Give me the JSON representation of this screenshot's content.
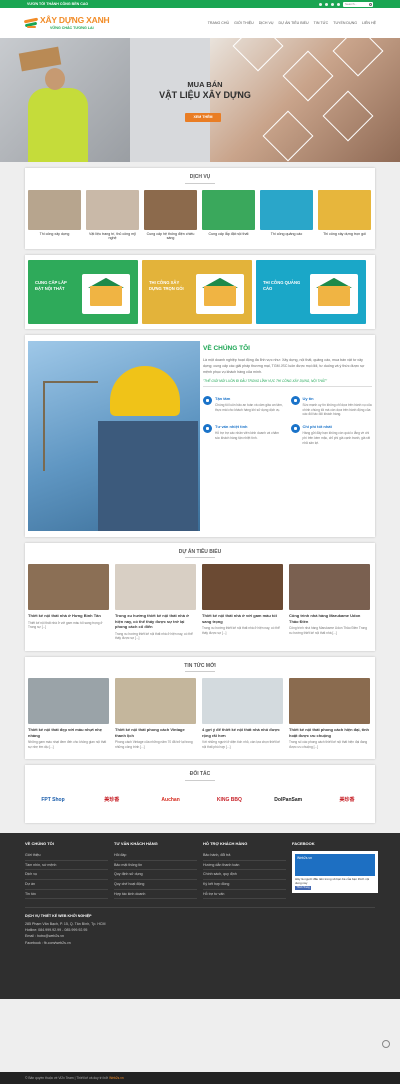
{
  "topbar": {
    "slogan": "VƯƠN TỚI THÀNH CÔNG BỀN CAO",
    "search_placeholder": "Search..."
  },
  "logo": {
    "name": "XÂY DỰNG XANH",
    "tagline": "VỮNG CHẮC TƯƠNG LAI"
  },
  "nav": [
    "TRANG CHỦ",
    "GIỚI THIỆU",
    "DỊCH VỤ",
    "DỰ ÁN TIÊU BIỂU",
    "TIN TỨC",
    "TUYỂN DỤNG",
    "LIÊN HỆ"
  ],
  "hero": {
    "line1": "MUA BÁN",
    "line2": "VẬT LIỆU XÂY DỰNG",
    "button": "XEM THÊM"
  },
  "services": {
    "title": "DỊCH VỤ",
    "items": [
      {
        "label": "Thi công xây dựng",
        "color": "#b7a58e"
      },
      {
        "label": "Vật liệu trang trí, thủ công mỹ nghệ",
        "color": "#c9b9a8"
      },
      {
        "label": "Cung cấp hệ thống điện chiếu sáng",
        "color": "#8c6a4c"
      },
      {
        "label": "Cung cấp lắp đặt nội thất",
        "color": "#3aa85c"
      },
      {
        "label": "Thi công quảng cáo",
        "color": "#2aa6c9"
      },
      {
        "label": "Thi công xây dựng trọn gói",
        "color": "#e7b63c"
      }
    ]
  },
  "banners": [
    {
      "label": "CUNG CẤP LẮP ĐẶT NỘI THẤT",
      "color": "#2eaa5a"
    },
    {
      "label": "THI CÔNG XÂY DỰNG TRỌN GÓI",
      "color": "#e3b33a"
    },
    {
      "label": "THI CÔNG QUẢNG CÁO",
      "color": "#1aa7c8"
    }
  ],
  "about": {
    "title": "VỀ CHÚNG TÔI",
    "text": "Là một doanh nghiệp hoạt động đa lĩnh vực như: Xây dựng, nội thất, quảng cáo, mua bán vật tư xây dựng; cung cấp các giải pháp thương mại, TGM JSC luôn được mọi đối, tư duống và ý thức được sự mệnh phục vụ khách hàng của mình.",
    "quote": "\"THẾ GIỚI MỚI LUÔN ĐI ĐẦU TRONG LĨNH VỰC THI CÔNG XÂY DỰNG, NỘI THẤT\"",
    "features": [
      {
        "title": "Tận tâm",
        "desc": "Chúng tôi luôn bảo an toàn và cảm giác an tâm, thực mái cho khách hàng khi sử dụng dịch vụ."
      },
      {
        "title": "Uy tín",
        "desc": "Sức mạnh uy tín không chỉ dựa trên hành vụ của chính chúng tôi mà còn dựa trên hành động của các đối tác đối khách hàng."
      },
      {
        "title": "Tư vấn nhiệt tình",
        "desc": "Hỗ trợ trợ các nhân viên kinh doanh và chăm sóc khách hàng tận nhiệt tình."
      },
      {
        "title": "Chi phí tốt nhất",
        "desc": "Hàng gửi đây bạn không còn quá lo lắng về chi phí trên kèm mặc, chỉ phí giá cạnh tranh, giá rất nhã sản lợi."
      }
    ]
  },
  "projects": {
    "title": "DỰ ÁN TIÊU BIỂU",
    "items": [
      {
        "title": "Thiết kế nội thất nhà ở Hưng Bình Tân",
        "desc": "Thiết kế nội thất nhà ở với gam màu tối sang trọng ở Trong sự [...]",
        "color": "#8b6f55"
      },
      {
        "title": "Trong xu hướng thiết kế nội thất nhà ở hiện nay, có thể thấy được sự trở lại phong cách cổ điển",
        "desc": "Trong xu hướng thiết kế nội thất nhà ở hiện nay, có thể thấy được sự [...]",
        "color": "#d8cfc4"
      },
      {
        "title": "Thiết kế nội thất nhà ở với gam màu tối sang trọng",
        "desc": "Trong xu hướng thiết kế nội thất nhà ở hiện nay, có thể thấy được sự [...]",
        "color": "#6b4a33"
      },
      {
        "title": "Công trình nhà hàng Marukame Udon Thảo Điền",
        "desc": "Công trình nhà hàng Marukame Udon Thảo Điền Trong xu hướng thiết kế nội thất nhà [...]",
        "color": "#7a6050"
      }
    ]
  },
  "news": {
    "title": "TIN TỨC MỚI",
    "items": [
      {
        "title": "Thiết kế nội thất đẹp với màu nhựt nhẹ nhàng",
        "desc": "Những gam màu nhạt đem đến cho không gian nội thất sự nhẹ êm dịu [...]",
        "color": "#9aa3a8"
      },
      {
        "title": "Thiết kế nội thất phong cách Vintage thanh lịch",
        "desc": "Phong cách Vintage của những năm 70 đã trở lại trong những công trình [...]",
        "color": "#c4b69c"
      },
      {
        "title": "4 gợi ý để thiết kế nội thất nhà nhỏ được rộng rãi hơn",
        "desc": "Với những người ở diện tích nhỏ, cần lựa chọn thiết kế nội thất phù hợp [...]",
        "color": "#d3dade"
      },
      {
        "title": "Thiết kế nội thất phong cách hiện đại, tinh hoặt được ưu chuộng",
        "desc": "Trong số các phong cách thiết kế nội thất hiện đại đang được ưu chuộng [...]",
        "color": "#8a6b4f"
      }
    ]
  },
  "partners": {
    "title": "ĐỐI TÁC",
    "items": [
      {
        "name": "FPT Shop",
        "color": "#1a5dab"
      },
      {
        "name": "美珍香",
        "color": "#c8232a"
      },
      {
        "name": "Auchan",
        "color": "#d52b1e"
      },
      {
        "name": "KING BBQ",
        "color": "#c8232a"
      },
      {
        "name": "DolPanSam",
        "color": "#222222"
      },
      {
        "name": "美珍香",
        "color": "#c8232a"
      }
    ]
  },
  "footer": {
    "cols": [
      {
        "title": "VỀ CHÚNG TÔI",
        "items": [
          "Giới thiệu",
          "Tầm nhìn, sứ mệnh",
          "Dịch vụ",
          "Dự án",
          "Tin tức"
        ]
      },
      {
        "title": "TƯ VẤN KHÁCH HÀNG",
        "items": [
          "Hỏi đáp",
          "Bảo mật thông tin",
          "Quy định sử dụng",
          "Quy chế hoạt động",
          "Hợp tác kinh doanh"
        ]
      },
      {
        "title": "HỖ TRỢ KHÁCH HÀNG",
        "items": [
          "Bảo hành, đổi trả",
          "Hướng dẫn thanh toán",
          "Chính sách, quy định",
          "Ký kết hợp đồng",
          "Hỗ trợ tư vấn"
        ]
      }
    ],
    "facebook": {
      "title": "FACEBOOK",
      "page": "Web2s.vn",
      "text": "Hãy là người đầu tiên trong số bạn bè của bạn thích nội dung này",
      "button": "Thích Trang"
    },
    "company": "DỊCH VỤ THIẾT KẾ WEB KHỞI NGHIỆP",
    "address": "285 Phạm Văn Bạch, P. 15, Q. Tân Bình, Tp. HCM",
    "hotline": "Hotline: 084.999.92.99 - 085.999.92.95",
    "email": "Email : hotro@web2s.vn",
    "fb": "Facebook : fb.com/web2s.vn",
    "copyright": "© Bản quyền thuộc về Vi2x Team | Thiết kế và duy trì bởi",
    "copyright_link": "Web2s.vn"
  }
}
